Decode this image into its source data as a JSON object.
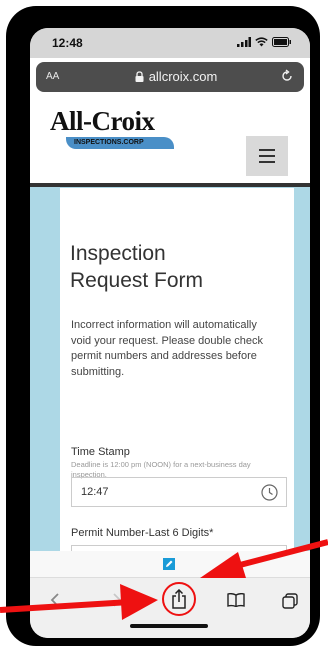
{
  "status_bar": {
    "time": "12:48"
  },
  "browser": {
    "text_size_label": "AA",
    "url": "allcroix.com"
  },
  "logo": {
    "main": "All-Croix",
    "sub": "INSPECTIONS.CORP"
  },
  "form": {
    "title_line1": "Inspection",
    "title_line2": "Request Form",
    "intro": "Incorrect information will automatically void your request. Please double check permit numbers and addresses before submitting.",
    "time_stamp_label": "Time Stamp",
    "time_stamp_help": "Deadline  is 12:00 pm (NOON) for a next-business day inspection.",
    "time_stamp_value": "12:47",
    "permit_label": "Permit Number-Last 6 Digits*"
  },
  "colors": {
    "page_bg": "#add8e6",
    "annotation_red": "#e11111",
    "accent_blue": "#1a9bd7"
  },
  "icons": [
    "signal-icon",
    "wifi-icon",
    "battery-icon",
    "lock-icon",
    "reload-icon",
    "hamburger-icon",
    "clock-icon",
    "edit-icon",
    "back-icon",
    "forward-icon",
    "share-icon",
    "bookmarks-icon",
    "tabs-icon"
  ]
}
